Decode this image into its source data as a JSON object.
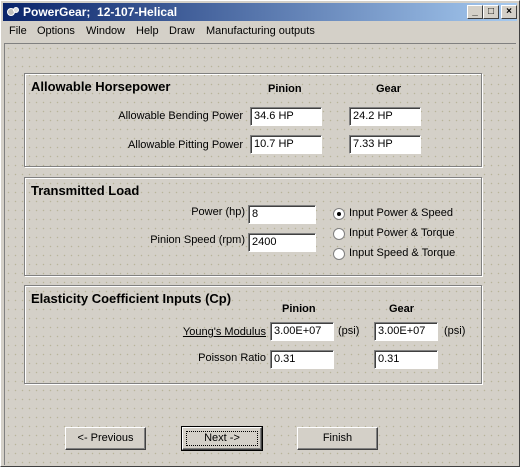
{
  "window": {
    "title": "PowerGear;  12-107-Helical"
  },
  "menu": [
    "File",
    "Options",
    "Window",
    "Help",
    "Draw",
    "Manufacturing outputs"
  ],
  "allowable_hp": {
    "title": "Allowable Horsepower",
    "col_pinion": "Pinion",
    "col_gear": "Gear",
    "rows": [
      {
        "label": "Allowable Bending Power",
        "pinion": "34.6 HP",
        "gear": "24.2 HP"
      },
      {
        "label": "Allowable Pitting Power",
        "pinion": "10.7 HP",
        "gear": "7.33 HP"
      }
    ]
  },
  "transmitted_load": {
    "title": "Transmitted Load",
    "power_label": "Power (hp)",
    "power_value": "8",
    "speed_label": "Pinion Speed (rpm)",
    "speed_value": "2400",
    "options": [
      "Input Power & Speed",
      "Input Power & Torque",
      "Input Speed & Torque"
    ],
    "selected_option": 0
  },
  "elasticity": {
    "title": "Elasticity Coefficient Inputs (Cp)",
    "col_pinion": "Pinion",
    "col_gear": "Gear",
    "youngs_label": "Young's Modulus",
    "youngs_pinion": "3.00E+07",
    "youngs_gear": "3.00E+07",
    "youngs_unit": "(psi)",
    "poisson_label": "Poisson Ratio",
    "poisson_pinion": "0.31",
    "poisson_gear": "0.31"
  },
  "buttons": {
    "previous": "<- Previous",
    "next": "Next ->",
    "finish": "Finish"
  }
}
